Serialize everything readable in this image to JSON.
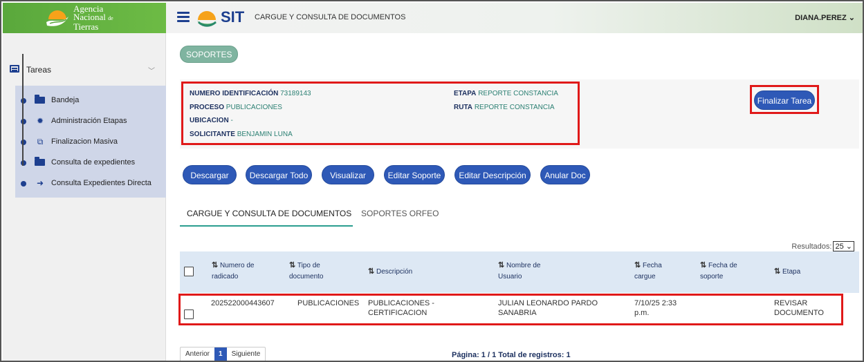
{
  "brand": {
    "logo_line1": "Agencia",
    "logo_line2": "Nacional",
    "logo_de": "de",
    "logo_line3": "Tierras",
    "app_logo_text": "SIT",
    "page_title": "CARGUE Y CONSULTA DE DOCUMENTOS",
    "user": "DIANA.PEREZ"
  },
  "sidebar": {
    "section_label": "Tareas",
    "items": [
      {
        "label": "Bandeja",
        "icon": "folder-open-icon"
      },
      {
        "label": "Administración Etapas",
        "icon": "gear-icon"
      },
      {
        "label": "Finalizacion Masiva",
        "icon": "copy-icon"
      },
      {
        "label": "Consulta de expedientes",
        "icon": "folder-open-icon"
      },
      {
        "label": "Consulta Expedientes Directa",
        "icon": "arrow-right-icon"
      }
    ]
  },
  "main": {
    "soportes_tab": "SOPORTES",
    "info": {
      "numero_label": "NUMERO IDENTIFICACIÓN",
      "numero_value": "73189143",
      "proceso_label": "PROCESO",
      "proceso_value": "PUBLICACIONES",
      "ubicacion_label": "UBICACION",
      "ubicacion_value": "-",
      "solicitante_label": "SOLICITANTE",
      "solicitante_value": "BENJAMIN LUNA",
      "etapa_label": "ETAPA",
      "etapa_value": "REPORTE CONSTANCIA",
      "ruta_label": "RUTA",
      "ruta_value": "REPORTE CONSTANCIA"
    },
    "finalizar_button": "Finalizar Tarea",
    "actions": [
      "Descargar",
      "Descargar Todo",
      "Visualizar",
      "Editar Soporte",
      "Editar Descripción",
      "Anular Doc"
    ],
    "tabs": [
      "CARGUE Y CONSULTA DE DOCUMENTOS",
      "SOPORTES ORFEO"
    ],
    "resultados_label": "Resultados:",
    "resultados_value": "25",
    "table": {
      "headers": [
        {
          "l1": "Numero de",
          "l2": "radicado"
        },
        {
          "l1": "Tipo de",
          "l2": "documento"
        },
        {
          "l1": "Descripción",
          "l2": ""
        },
        {
          "l1": "Nombre de",
          "l2": "Usuario"
        },
        {
          "l1": "Fecha",
          "l2": "cargue"
        },
        {
          "l1": "Fecha de",
          "l2": "soporte"
        },
        {
          "l1": "Etapa",
          "l2": ""
        }
      ],
      "rows": [
        {
          "radicado": "202522000443607",
          "tipo": "PUBLICACIONES",
          "desc_l1": "PUBLICACIONES -",
          "desc_l2": "CERTIFICACION",
          "usuario_l1": "JULIAN LEONARDO PARDO",
          "usuario_l2": "SANABRIA",
          "fecha_l1": "7/10/25 2:33",
          "fecha_l2": "p.m.",
          "soporte": "",
          "etapa_l1": "REVISAR",
          "etapa_l2": "DOCUMENTO"
        }
      ]
    },
    "pager": {
      "prev": "Anterior",
      "current": "1",
      "next": "Siguiente"
    },
    "pagina_text": "Página: 1 / 1 Total de registros: 1"
  },
  "colors": {
    "accent": "#2e59b7",
    "highlight_border": "#e01919",
    "sidebar_submenu": "#cfd6e8",
    "brand_green": "#5aa83c"
  }
}
